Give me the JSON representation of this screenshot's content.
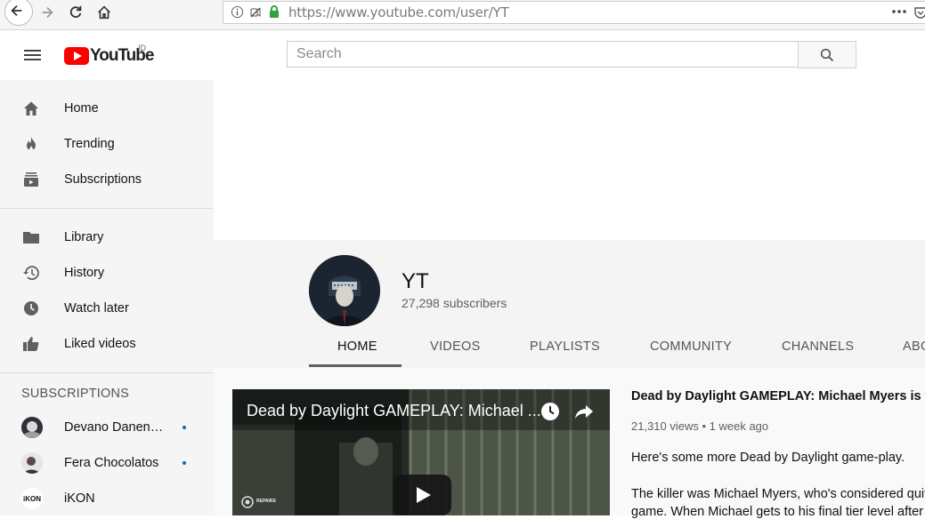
{
  "browser": {
    "url": "https://www.youtube.com/user/YT"
  },
  "header": {
    "logo_text": "YouTube",
    "country_code": "ID",
    "search_placeholder": "Search"
  },
  "sidebar": {
    "primary": [
      {
        "label": "Home",
        "icon": "home-icon"
      },
      {
        "label": "Trending",
        "icon": "flame-icon"
      },
      {
        "label": "Subscriptions",
        "icon": "subscriptions-icon"
      }
    ],
    "library": [
      {
        "label": "Library",
        "icon": "folder-icon"
      },
      {
        "label": "History",
        "icon": "history-icon"
      },
      {
        "label": "Watch later",
        "icon": "clock-icon"
      },
      {
        "label": "Liked videos",
        "icon": "thumbs-up-icon"
      }
    ],
    "subscriptions_heading": "SUBSCRIPTIONS",
    "subscriptions": [
      {
        "label": "Devano Danen…",
        "new": true
      },
      {
        "label": "Fera Chocolatos",
        "new": true
      },
      {
        "label": "iKON",
        "new": false,
        "avatar_text": "iKON"
      }
    ]
  },
  "channel": {
    "name": "YT",
    "subscribers": "27,298 subscribers",
    "tabs": [
      "HOME",
      "VIDEOS",
      "PLAYLISTS",
      "COMMUNITY",
      "CHANNELS",
      "ABO"
    ],
    "active_tab": "HOME"
  },
  "featured_video": {
    "overlay_title": "Dead by Daylight GAMEPLAY: Michael ...",
    "title": "Dead by Daylight GAMEPLAY: Michael Myers is too O",
    "meta": "21,310 views • 1 week ago",
    "description_line1": "Here's some more Dead by Daylight game-play.",
    "description_line2": "The killer was Michael Myers, who's considered quite O",
    "description_line3": "game. When Michael gets to his final tier level after wa",
    "badge_text": "REPAIRS"
  },
  "colors": {
    "brand_red": "#ff0000",
    "sidebar_bg": "#f5f5f5",
    "subscription_dot": "#1565c0"
  }
}
